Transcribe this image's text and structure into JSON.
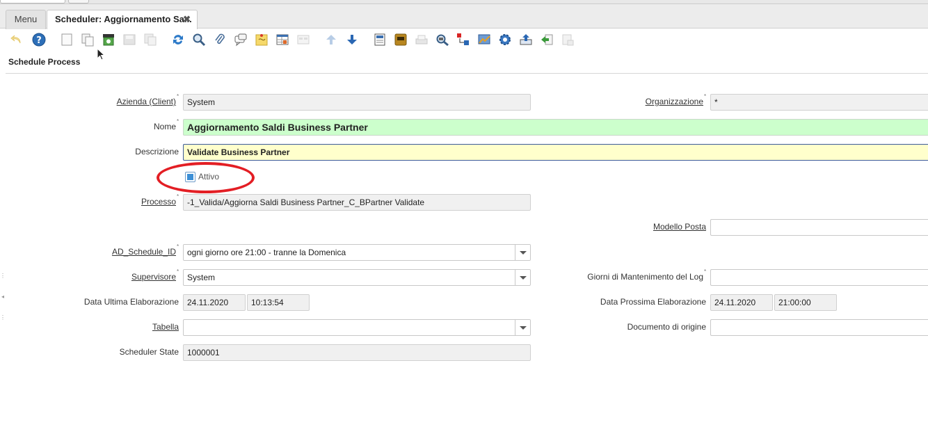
{
  "tabs": {
    "menu_label": "Menu",
    "active_label": "Scheduler: Aggiornamento Sa...",
    "close_glyph": "✖"
  },
  "toolbar": {
    "icons": [
      "undo-icon",
      "help-icon",
      "new-record-icon",
      "copy-record-icon",
      "archive-icon",
      "save-icon",
      "save-new-icon",
      "refresh-icon",
      "find-icon",
      "attachment-icon",
      "chat-icon",
      "postit-icon",
      "grid-toggle-icon",
      "detail-icon",
      "prev-record-icon",
      "next-record-icon",
      "report-icon",
      "archived-docs-icon",
      "print-icon",
      "zoom-across-icon",
      "active-workflows-icon",
      "requests-icon",
      "process-gear-icon",
      "export-icon",
      "import-icon",
      "quick-form-icon"
    ]
  },
  "page_title": "Schedule Process",
  "form": {
    "client_label": "Azienda (Client)",
    "client_value": "System",
    "org_label": "Organizzazione",
    "org_value": "*",
    "name_label": "Nome",
    "name_value": "Aggiornamento Saldi Business Partner",
    "desc_label": "Descrizione",
    "desc_value": "Validate Business Partner",
    "active_label": "Attivo",
    "active_checked": true,
    "process_label": "Processo",
    "process_value": "-1_Valida/Aggiorna Saldi Business Partner_C_BPartner Validate",
    "mail_template_label": "Modello Posta",
    "mail_template_value": "",
    "schedule_label": "AD_Schedule_ID",
    "schedule_value": "ogni giorno ore 21:00 - tranne la Domenica",
    "supervisor_label": "Supervisore",
    "supervisor_value": "System",
    "keep_log_label": "Giorni di Mantenimento del Log",
    "keep_log_value": "",
    "last_run_label": "Data Ultima Elaborazione",
    "last_run_date": "24.11.2020",
    "last_run_time": "10:13:54",
    "next_run_label": "Data Prossima Elaborazione",
    "next_run_date": "24.11.2020",
    "next_run_time": "21:00:00",
    "table_label": "Tabella",
    "table_value": "",
    "source_doc_label": "Documento di origine",
    "source_doc_value": "",
    "state_label": "Scheduler State",
    "state_value": "1000001"
  },
  "colors": {
    "mandatory_green": "#ccffcc",
    "focus_yellow": "#ffffcc",
    "annotation_red": "#e31e24",
    "checkbox_blue": "#3c8fd6"
  }
}
